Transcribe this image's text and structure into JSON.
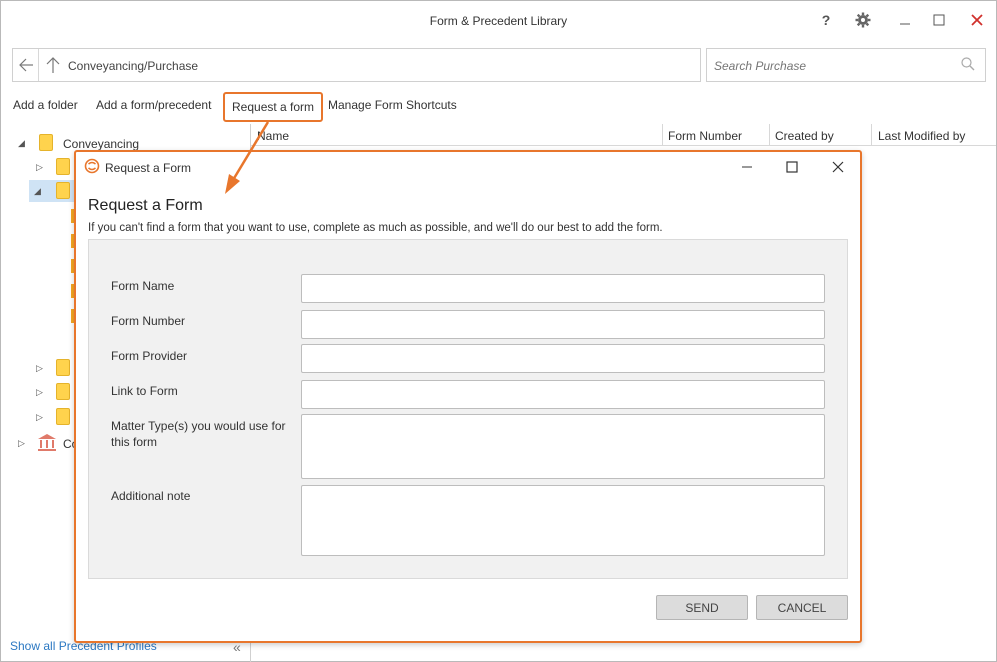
{
  "window": {
    "title": "Form & Precedent Library",
    "help_glyph": "?",
    "settings_glyph": "⚙",
    "minimize_glyph": "—",
    "maximize_glyph": "☐",
    "close_glyph": "✕"
  },
  "nav": {
    "path": "Conveyancing/Purchase",
    "back_icon": "back-arrow-icon",
    "up_icon": "up-arrow-icon"
  },
  "search": {
    "placeholder": "Search Purchase"
  },
  "toolbar": {
    "add_folder": "Add a folder",
    "add_form": "Add a form/precedent",
    "request_form": "Request a form",
    "manage_shortcuts": "Manage Form Shortcuts"
  },
  "tree": {
    "root_label": "Conveyancing",
    "collapsed_label": "Co"
  },
  "grid": {
    "columns": [
      "Name",
      "Form Number",
      "Created by",
      "Last Modified by"
    ]
  },
  "footer": {
    "show_all": "Show all Precedent Profiles",
    "collapse_glyph": "«"
  },
  "dialog": {
    "title": "Request a Form",
    "heading": "Request a Form",
    "subtitle": "If you can't find a form that you want to use, complete as much as possible, and we'll do our best to add the form.",
    "fields": [
      {
        "label": "Form Name",
        "value": ""
      },
      {
        "label": "Form Number",
        "value": ""
      },
      {
        "label": "Form Provider",
        "value": ""
      },
      {
        "label": "Link to Form",
        "value": ""
      },
      {
        "label": "Matter Type(s) you would use for this form",
        "value": ""
      },
      {
        "label": "Additional note",
        "value": ""
      }
    ],
    "send_label": "SEND",
    "cancel_label": "CANCEL"
  },
  "colors": {
    "accent": "#e8762c",
    "folder": "#ffd34d",
    "selection": "#cfe3f5",
    "link": "#2b78c2"
  }
}
